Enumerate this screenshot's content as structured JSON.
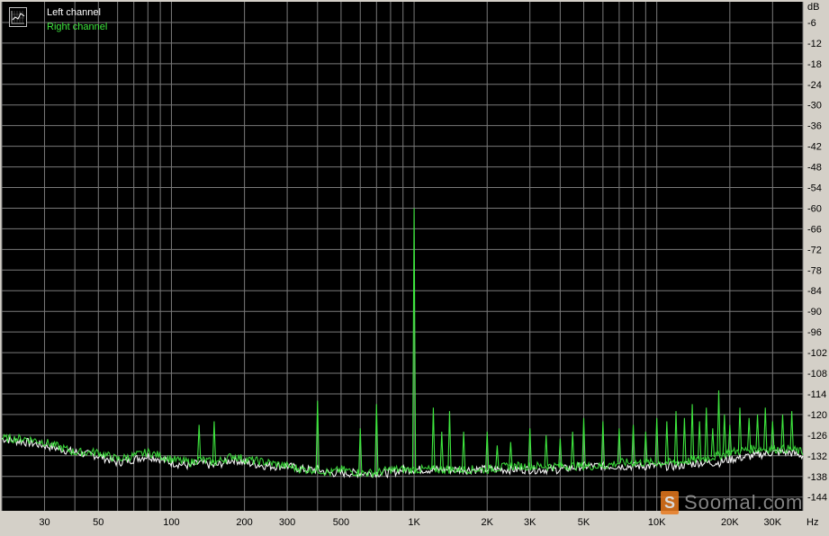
{
  "chart_data": {
    "type": "line",
    "title": "",
    "xlabel": "",
    "ylabel": "",
    "x_unit": "Hz",
    "y_unit": "dB",
    "x_scale": "log",
    "xlim": [
      20,
      40000
    ],
    "ylim": [
      -148,
      0
    ],
    "grid": true,
    "legend_placement": "top-left",
    "x_tick_labels": [
      {
        "value": 30,
        "label": "30"
      },
      {
        "value": 50,
        "label": "50"
      },
      {
        "value": 100,
        "label": "100"
      },
      {
        "value": 200,
        "label": "200"
      },
      {
        "value": 300,
        "label": "300"
      },
      {
        "value": 500,
        "label": "500"
      },
      {
        "value": 1000,
        "label": "1K"
      },
      {
        "value": 2000,
        "label": "2K"
      },
      {
        "value": 3000,
        "label": "3K"
      },
      {
        "value": 5000,
        "label": "5K"
      },
      {
        "value": 10000,
        "label": "10K"
      },
      {
        "value": 20000,
        "label": "20K"
      },
      {
        "value": 30000,
        "label": "30K"
      }
    ],
    "y_ticks": [
      -6,
      -12,
      -18,
      -24,
      -30,
      -36,
      -42,
      -48,
      -54,
      -60,
      -66,
      -72,
      -78,
      -84,
      -90,
      -96,
      -102,
      -108,
      -114,
      -120,
      -126,
      -132,
      -138,
      -144
    ],
    "series": [
      {
        "name": "Left channel",
        "color": "#ffffff",
        "x": [
          20,
          25,
          30,
          40,
          50,
          60,
          70,
          80,
          90,
          100,
          120,
          130,
          150,
          180,
          200,
          250,
          300,
          350,
          400,
          450,
          500,
          600,
          700,
          800,
          900,
          1000,
          1100,
          1300,
          1500,
          2000,
          2500,
          3000,
          4000,
          5000,
          6000,
          7000,
          8000,
          10000,
          12000,
          15000,
          18000,
          20000,
          25000,
          30000,
          35000,
          40000
        ],
        "y": [
          -127,
          -128,
          -129,
          -131,
          -132,
          -134,
          -133,
          -132,
          -133,
          -134,
          -135,
          -134,
          -135,
          -133,
          -134,
          -135,
          -135,
          -136,
          -136,
          -137,
          -137,
          -137,
          -137,
          -137,
          -136,
          -136,
          -136,
          -136,
          -136,
          -136,
          -136,
          -136,
          -136,
          -135,
          -135,
          -135,
          -135,
          -135,
          -135,
          -134,
          -134,
          -133,
          -132,
          -131,
          -131,
          -132
        ]
      },
      {
        "name": "Right channel",
        "color": "#3ee63e",
        "x": [
          20,
          25,
          30,
          40,
          50,
          60,
          70,
          80,
          90,
          100,
          120,
          130,
          150,
          180,
          200,
          250,
          300,
          350,
          400,
          450,
          500,
          600,
          700,
          800,
          900,
          1000,
          1100,
          1300,
          1500,
          2000,
          2500,
          3000,
          4000,
          5000,
          6000,
          7000,
          8000,
          10000,
          12000,
          15000,
          18000,
          20000,
          25000,
          30000,
          35000,
          40000
        ],
        "y": [
          -127,
          -127,
          -128,
          -131,
          -131,
          -133,
          -132,
          -131,
          -132,
          -133,
          -134,
          -133,
          -134,
          -132,
          -133,
          -134,
          -135,
          -136,
          -136,
          -137,
          -136,
          -137,
          -137,
          -136,
          -136,
          -136,
          -136,
          -136,
          -136,
          -136,
          -135,
          -135,
          -135,
          -135,
          -135,
          -134,
          -134,
          -134,
          -134,
          -133,
          -132,
          -131,
          -130,
          -130,
          -130,
          -131
        ]
      }
    ],
    "peaks": {
      "Right channel": [
        {
          "x": 130,
          "y": -123
        },
        {
          "x": 150,
          "y": -122
        },
        {
          "x": 400,
          "y": -116
        },
        {
          "x": 600,
          "y": -124
        },
        {
          "x": 700,
          "y": -117
        },
        {
          "x": 1000,
          "y": -60
        },
        {
          "x": 1200,
          "y": -118
        },
        {
          "x": 1300,
          "y": -125
        },
        {
          "x": 1400,
          "y": -119
        },
        {
          "x": 1600,
          "y": -125
        },
        {
          "x": 2000,
          "y": -125
        },
        {
          "x": 2200,
          "y": -129
        },
        {
          "x": 2500,
          "y": -128
        },
        {
          "x": 3000,
          "y": -124
        },
        {
          "x": 3500,
          "y": -126
        },
        {
          "x": 4000,
          "y": -127
        },
        {
          "x": 4500,
          "y": -125
        },
        {
          "x": 5000,
          "y": -121
        },
        {
          "x": 6000,
          "y": -122
        },
        {
          "x": 7000,
          "y": -124
        },
        {
          "x": 8000,
          "y": -123
        },
        {
          "x": 9000,
          "y": -125
        },
        {
          "x": 10000,
          "y": -121
        },
        {
          "x": 11000,
          "y": -122
        },
        {
          "x": 12000,
          "y": -119
        },
        {
          "x": 13000,
          "y": -121
        },
        {
          "x": 14000,
          "y": -117
        },
        {
          "x": 15000,
          "y": -122
        },
        {
          "x": 16000,
          "y": -118
        },
        {
          "x": 17000,
          "y": -124
        },
        {
          "x": 18000,
          "y": -113
        },
        {
          "x": 19000,
          "y": -120
        },
        {
          "x": 20000,
          "y": -123
        },
        {
          "x": 22000,
          "y": -118
        },
        {
          "x": 24000,
          "y": -121
        },
        {
          "x": 26000,
          "y": -120
        },
        {
          "x": 28000,
          "y": -118
        },
        {
          "x": 30000,
          "y": -122
        },
        {
          "x": 33000,
          "y": -120
        },
        {
          "x": 36000,
          "y": -119
        }
      ]
    }
  },
  "labels": {
    "y_unit_label": "dB",
    "x_unit_label": "Hz",
    "legend_left": "Left channel",
    "legend_right": "Right channel"
  },
  "watermark": {
    "logo_letter": "S",
    "text": "Soomal.com"
  },
  "colors": {
    "plot_background": "#000000",
    "grid_color": "#7a7a7a",
    "frame_background": "#d4d0c8",
    "left_channel": "#ffffff",
    "right_channel": "#3ee63e"
  },
  "icons": {
    "legend_icon": "chart-icon"
  }
}
